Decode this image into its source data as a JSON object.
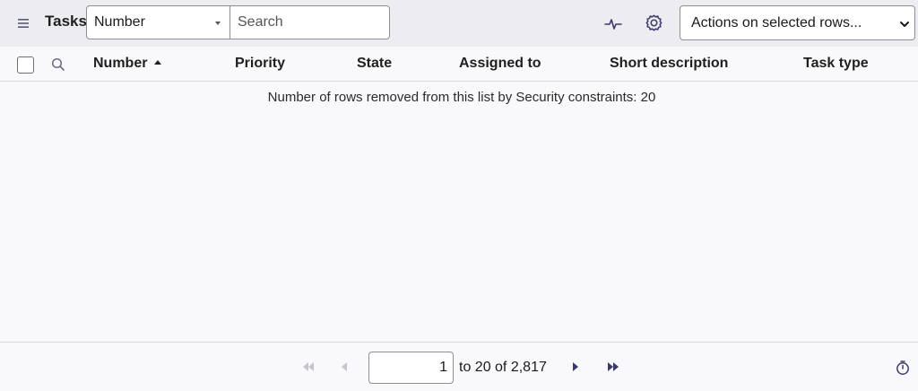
{
  "header": {
    "title": "Tasks",
    "field_select_value": "Number",
    "search_placeholder": "Search",
    "actions_select_value": "Actions on selected rows..."
  },
  "icons": {
    "menu": "menu-icon",
    "pulse": "pulse-icon",
    "gear": "gear-icon",
    "column_search": "search-icon",
    "timer": "timer-icon"
  },
  "columns": [
    {
      "label": "Number",
      "sorted": "ascending"
    },
    {
      "label": "Priority"
    },
    {
      "label": "State"
    },
    {
      "label": "Assigned to"
    },
    {
      "label": "Short description"
    },
    {
      "label": "Task type"
    }
  ],
  "message": "Number of rows removed from this list by Security constraints: 20",
  "pagination": {
    "current_page_value": "1",
    "range_text": "to 20 of 2,817"
  },
  "colors": {
    "header_bg": "#ededf1",
    "accent_icon": "#3b3b6b",
    "disabled_nav": "#c4c4ce"
  }
}
